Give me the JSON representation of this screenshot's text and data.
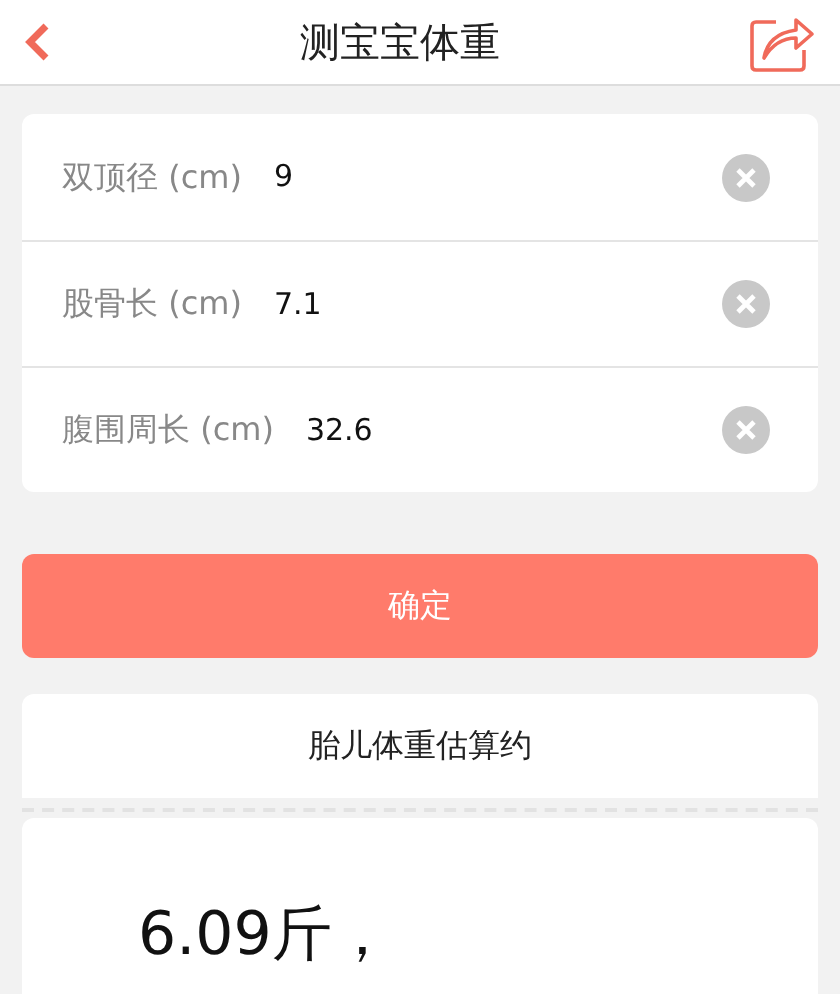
{
  "header": {
    "title": "测宝宝体重"
  },
  "fields": [
    {
      "label": "双顶径 (cm)",
      "value": "9"
    },
    {
      "label": "股骨长 (cm)",
      "value": "7.1"
    },
    {
      "label": "腹围周长 (cm)",
      "value": "32.6"
    }
  ],
  "confirm_button": "确定",
  "result": {
    "heading": "胎儿体重估算约",
    "value": "6.09斤，"
  }
}
